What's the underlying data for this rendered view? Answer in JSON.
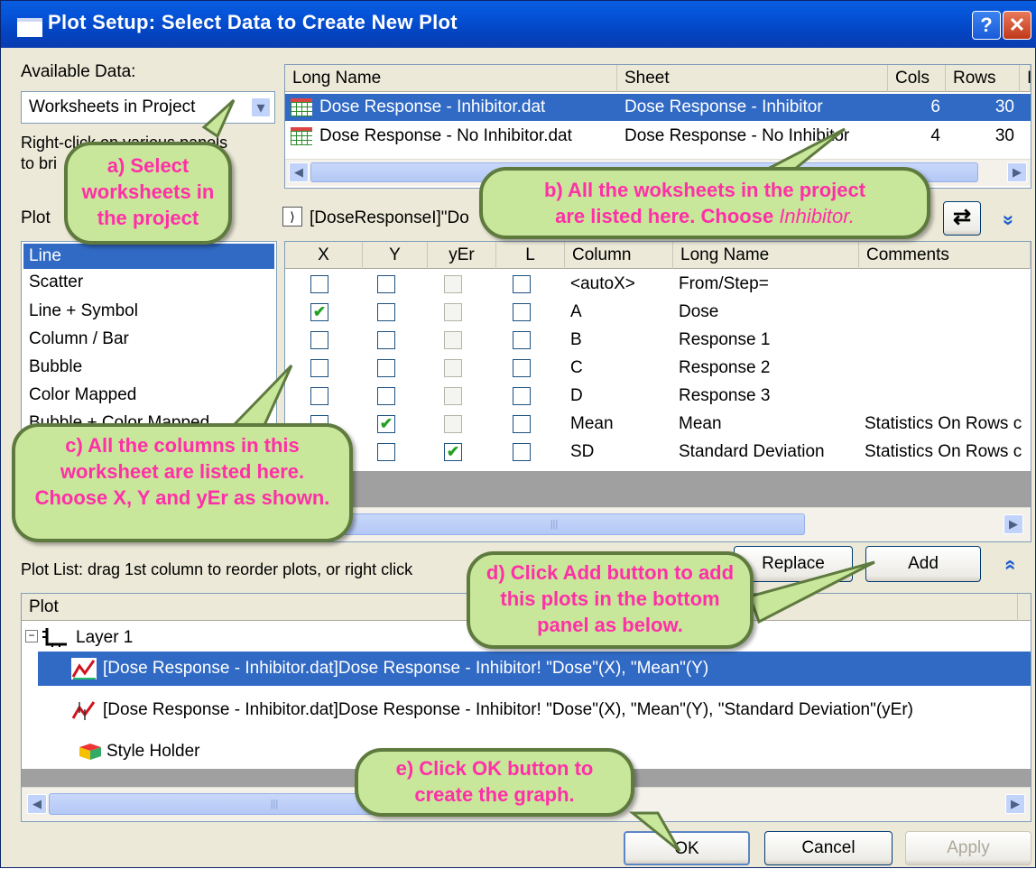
{
  "window": {
    "title": "Plot Setup: Select Data to Create New Plot"
  },
  "available": {
    "label": "Available Data:",
    "selected": "Worksheets in Project",
    "hint_line1": "Right-click on various panels",
    "hint_line2": "to bri"
  },
  "plot_type": {
    "label": "Plot",
    "items": [
      "Line",
      "Scatter",
      "Line + Symbol",
      "Column / Bar",
      "Bubble",
      "Color Mapped",
      "Bubble + Color Mapped"
    ]
  },
  "sheets_table": {
    "headers": [
      "Long Name",
      "Sheet",
      "Cols",
      "Rows",
      "I"
    ],
    "rows": [
      {
        "long_name": "Dose Response - Inhibitor.dat",
        "sheet": "Dose Response - Inhibitor",
        "cols": "6",
        "rows": "30"
      },
      {
        "long_name": "Dose Response - No Inhibitor.dat",
        "sheet": "Dose Response - No Inhibitor",
        "cols": "4",
        "rows": "30"
      }
    ]
  },
  "path_text": "[DoseResponseI]\"Do",
  "columns_table": {
    "headers": [
      "X",
      "Y",
      "yEr",
      "L",
      "Column",
      "Long Name",
      "Comments"
    ],
    "rows": [
      {
        "x": false,
        "y": false,
        "yer": false,
        "l": false,
        "column": "<autoX>",
        "long_name": "From/Step=",
        "comments": ""
      },
      {
        "x": true,
        "y": false,
        "yer": false,
        "l": false,
        "column": "A",
        "long_name": "Dose",
        "comments": ""
      },
      {
        "x": false,
        "y": false,
        "yer": false,
        "l": false,
        "column": "B",
        "long_name": "Response 1",
        "comments": ""
      },
      {
        "x": false,
        "y": false,
        "yer": false,
        "l": false,
        "column": "C",
        "long_name": "Response 2",
        "comments": ""
      },
      {
        "x": false,
        "y": false,
        "yer": false,
        "l": false,
        "column": "D",
        "long_name": "Response 3",
        "comments": ""
      },
      {
        "x": false,
        "y": true,
        "yer": false,
        "l": false,
        "column": "Mean",
        "long_name": "Mean",
        "comments": "Statistics On Rows c"
      },
      {
        "x": false,
        "y": false,
        "yer": true,
        "l": false,
        "column": "SD",
        "long_name": "Standard Deviation",
        "comments": "Statistics On Rows c"
      }
    ],
    "check_mark": "✔"
  },
  "buttons": {
    "replace": "Replace",
    "add": "Add",
    "ok": "OK",
    "cancel": "Cancel",
    "apply": "Apply"
  },
  "plot_list": {
    "label": "Plot List: drag 1st column to reorder plots, or right click",
    "header": "Plot",
    "layer": "Layer 1",
    "items": [
      "[Dose Response - Inhibitor.dat]Dose Response - Inhibitor! \"Dose\"(X), \"Mean\"(Y)",
      "[Dose Response - Inhibitor.dat]Dose Response - Inhibitor! \"Dose\"(X), \"Mean\"(Y), \"Standard Deviation\"(yEr)"
    ],
    "style_holder": "Style Holder",
    "expander": "⊟"
  },
  "callouts": {
    "a": "a) Select worksheets in the project",
    "b_line1": "b) All the woksheets in the project",
    "b_line2": "are listed here. Choose",
    "b_italic": "Inhibitor.",
    "c": "c) All the columns in this worksheet are listed here. Choose X, Y and yEr as shown.",
    "d": "d) Click Add button to add this plots in the bottom panel as below.",
    "e": "e) Click OK button to create the graph."
  },
  "icons": {
    "help": "?",
    "close": "✕",
    "combo_arrow": "▾",
    "expand_small": "⟩",
    "swap": "⇄",
    "chevrons_down": "»",
    "chevrons_up": "»",
    "left": "◀",
    "right": "▶",
    "thumb_grip": "|||"
  },
  "colors": {
    "selection": "#316ac5",
    "titlebar": "#0553d8",
    "callout_fill": "#c9e79b",
    "callout_text": "#ff2fa8"
  }
}
